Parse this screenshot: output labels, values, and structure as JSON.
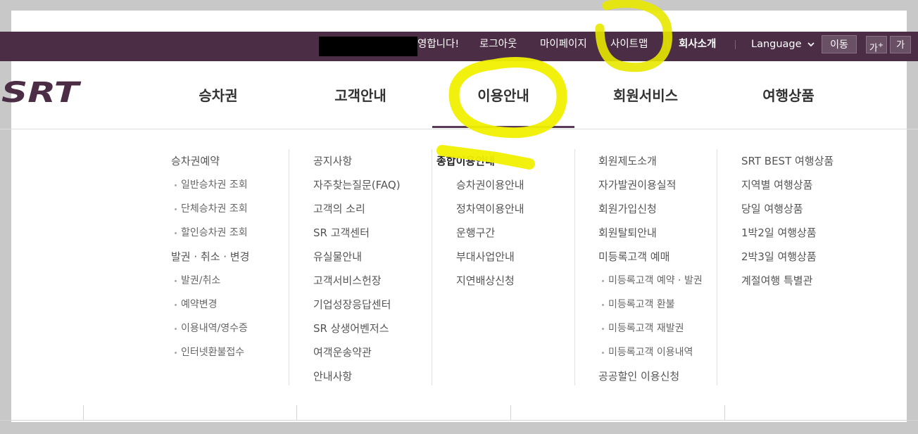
{
  "topbar": {
    "welcome": "영합니다!",
    "logout": "로그아웃",
    "mypage": "마이페이지",
    "sitemap": "사이트맵",
    "company": "회사소개",
    "language": "Language",
    "go_button": "이동",
    "font_larger": "가",
    "font_larger_sup": "+",
    "font_normal": "가"
  },
  "logo": {
    "text": "SRT",
    "color": "#4b2e45"
  },
  "gnb": [
    {
      "label": "승차권"
    },
    {
      "label": "고객안내"
    },
    {
      "label": "이용안내",
      "active": true
    },
    {
      "label": "회원서비스"
    },
    {
      "label": "여행상품"
    }
  ],
  "menu": {
    "col1": [
      "승차권예약",
      "일반승차권 조회",
      "단체승차권 조회",
      "할인승차권 조회",
      "발권 · 취소 · 변경",
      "발권/취소",
      "예약변경",
      "이용내역/영수증",
      "인터넷환불접수"
    ],
    "col2": [
      "공지사항",
      "자주찾는질문(FAQ)",
      "고객의 소리",
      "SR 고객센터",
      "유실물안내",
      "고객서비스헌장",
      "기업성장응답센터",
      "SR 상생어벤저스",
      "여객운송약관",
      "안내사항"
    ],
    "col3": [
      "종합이용안내",
      "승차권이용안내",
      "정차역이용안내",
      "운행구간",
      "부대사업안내",
      "지연배상신청"
    ],
    "col4": [
      "회원제도소개",
      "자가발권이용실적",
      "회원가입신청",
      "회원탈퇴안내",
      "미등록고객 예매",
      "미등록고객 예약 · 발권",
      "미등록고객 환불",
      "미등록고객 재발권",
      "미등록고객 이용내역",
      "공공할인 이용신청"
    ],
    "col5": [
      "SRT BEST 여행상품",
      "지역별 여행상품",
      "당일 여행상품",
      "1박2일 여행상품",
      "2박3일 여행상품",
      "계절여행 특별관"
    ]
  },
  "colors": {
    "topbar": "#4b2e45",
    "highlighter": "#f0f000",
    "active_bar": "#5a3a58"
  }
}
